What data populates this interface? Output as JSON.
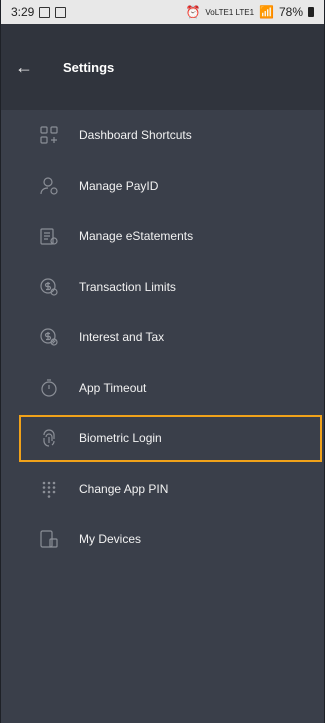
{
  "status_bar": {
    "time": "3:29",
    "battery": "78%",
    "network": "VoLTE1 LTE1"
  },
  "header": {
    "title": "Settings",
    "back_icon": "arrow-left-icon"
  },
  "settings": {
    "items": [
      {
        "label": "Dashboard Shortcuts",
        "icon": "grid-plus-icon"
      },
      {
        "label": "Manage PayID",
        "icon": "user-gear-icon"
      },
      {
        "label": "Manage eStatements",
        "icon": "document-gear-icon"
      },
      {
        "label": "Transaction Limits",
        "icon": "dollar-gear-icon"
      },
      {
        "label": "Interest and Tax",
        "icon": "dollar-percent-icon"
      },
      {
        "label": "App Timeout",
        "icon": "timer-icon"
      },
      {
        "label": "Biometric Login",
        "icon": "fingerprint-icon"
      },
      {
        "label": "Change App PIN",
        "icon": "keypad-icon"
      },
      {
        "label": "My Devices",
        "icon": "devices-icon"
      }
    ]
  },
  "colors": {
    "background": "#3a3f4a",
    "header": "#30343d",
    "highlight": "#f0a21a",
    "icon": "#8b8f97"
  }
}
